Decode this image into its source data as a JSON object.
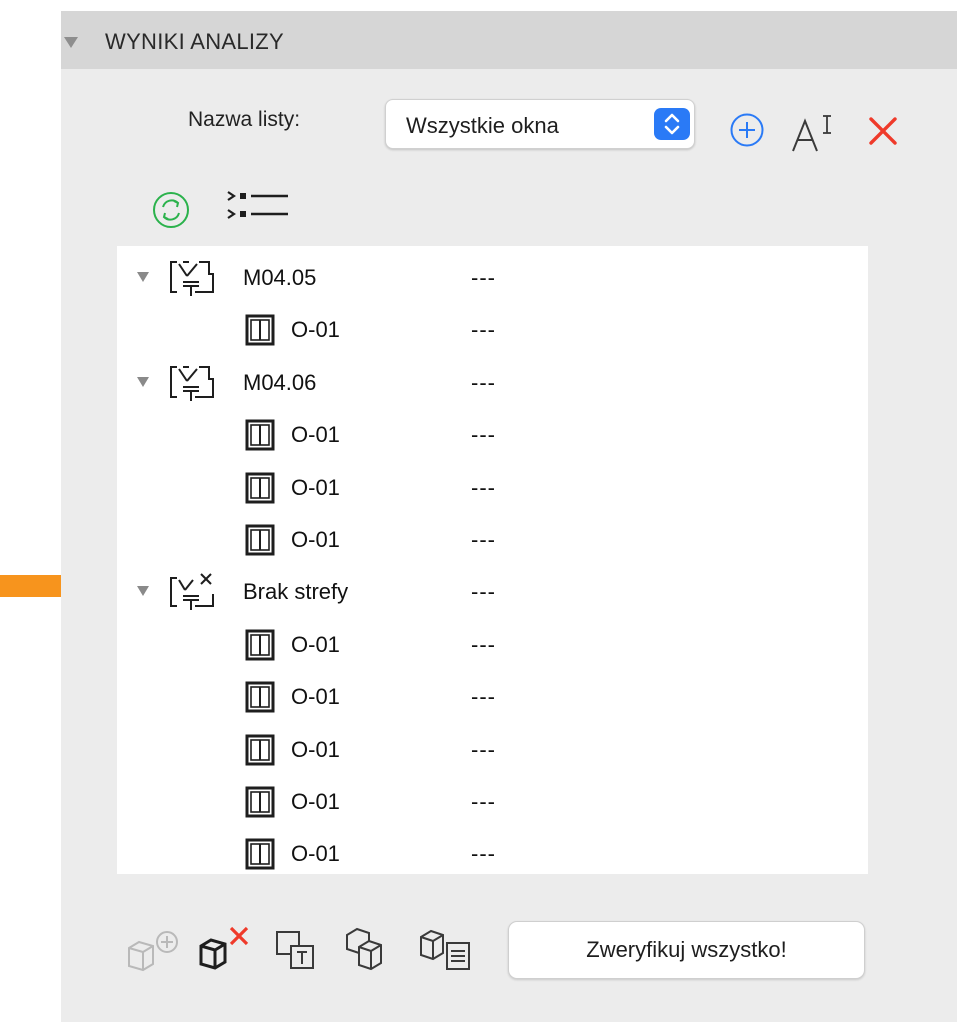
{
  "panel": {
    "title": "WYNIKI ANALIZY",
    "list_label": "Nazwa listy:",
    "list_select_value": "Wszystkie okna",
    "verify_button": "Zweryfikuj wszystko!"
  },
  "colors": {
    "accent_blue": "#2a7af6",
    "delete_red": "#ef3a2a",
    "refresh_green": "#2bb24c",
    "arrow_orange": "#f7941d"
  },
  "icons": {
    "add": "plus-circle-icon",
    "rename": "text-cursor-icon",
    "delete": "close-icon",
    "refresh": "refresh-icon",
    "expand_all": "expand-list-icon",
    "zone": "zone-icon",
    "zone_missing": "zone-missing-icon",
    "window": "window-icon"
  },
  "tree": {
    "rows": [
      {
        "type": "zone",
        "name": "M04.05",
        "value": "---"
      },
      {
        "type": "window",
        "name": "O-01",
        "value": "---"
      },
      {
        "type": "zone",
        "name": "M04.06",
        "value": "---"
      },
      {
        "type": "window",
        "name": "O-01",
        "value": "---"
      },
      {
        "type": "window",
        "name": "O-01",
        "value": "---"
      },
      {
        "type": "window",
        "name": "O-01",
        "value": "---"
      },
      {
        "type": "zone-missing",
        "name": "Brak strefy",
        "value": "---"
      },
      {
        "type": "window",
        "name": "O-01",
        "value": "---"
      },
      {
        "type": "window",
        "name": "O-01",
        "value": "---"
      },
      {
        "type": "window",
        "name": "O-01",
        "value": "---"
      },
      {
        "type": "window",
        "name": "O-01",
        "value": "---"
      },
      {
        "type": "window",
        "name": "O-01",
        "value": "---"
      }
    ]
  }
}
